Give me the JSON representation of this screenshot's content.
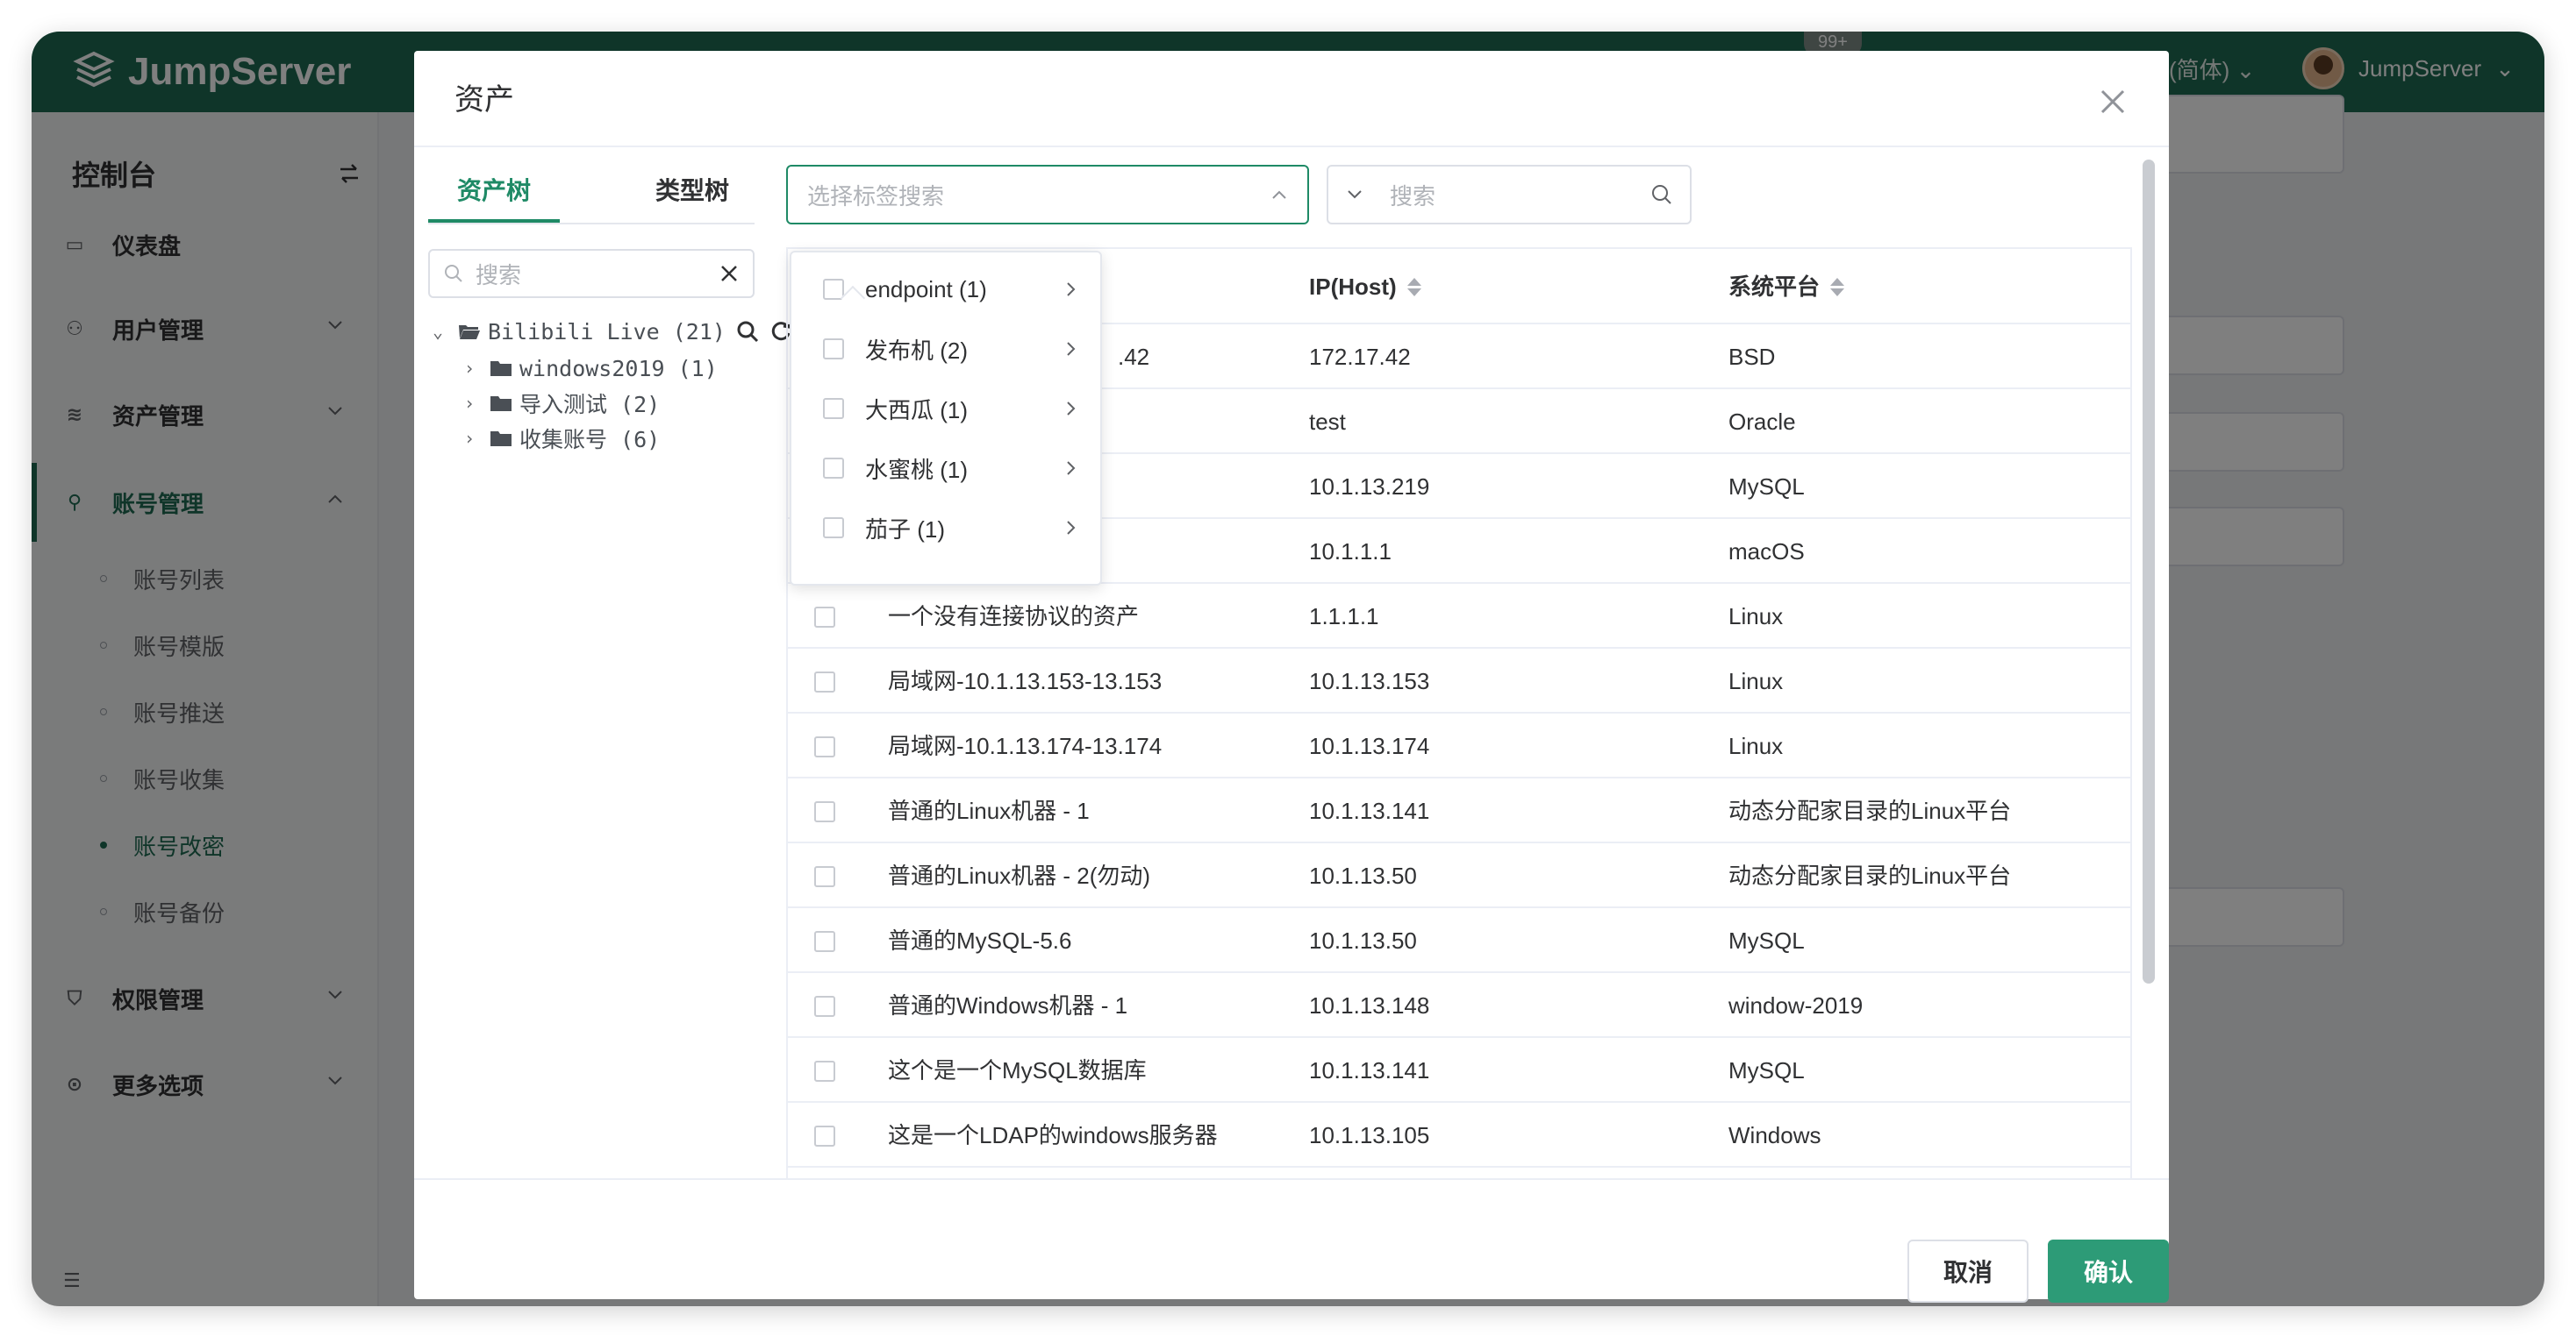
{
  "app": {
    "logo_text": "JumpServer",
    "notify_badge": "99+",
    "language": "(简体)",
    "username": "JumpServer"
  },
  "sidebar": {
    "title": "控制台",
    "items": [
      {
        "label": "仪表盘"
      },
      {
        "label": "用户管理"
      },
      {
        "label": "资产管理"
      },
      {
        "label": "账号管理"
      },
      {
        "label": "权限管理"
      },
      {
        "label": "更多选项"
      }
    ],
    "sub_items": [
      {
        "label": "账号列表"
      },
      {
        "label": "账号模版"
      },
      {
        "label": "账号推送"
      },
      {
        "label": "账号收集"
      },
      {
        "label": "账号改密"
      },
      {
        "label": "账号备份"
      }
    ]
  },
  "modal": {
    "title": "资产",
    "tabs": [
      {
        "label": "资产树"
      },
      {
        "label": "类型树"
      }
    ],
    "tree_search_placeholder": "搜索",
    "tree": {
      "root": "Bilibili Live (21)",
      "children": [
        "windows2019 (1)",
        "导入测试 (2)",
        "收集账号 (6)"
      ]
    },
    "tag_select_placeholder": "选择标签搜索",
    "search_placeholder": "搜索",
    "columns": [
      "IP(Host)",
      "系统平台"
    ],
    "rows": [
      {
        "name": "",
        "partial": ".42",
        "ip": "172.17.42",
        "platform": "BSD"
      },
      {
        "name": "",
        "partial": "",
        "ip": "test",
        "platform": "Oracle"
      },
      {
        "name": "",
        "partial": "",
        "ip": "10.1.13.219",
        "platform": "MySQL"
      },
      {
        "name": "",
        "partial": "",
        "ip": "10.1.1.1",
        "platform": "macOS"
      },
      {
        "name": "一个没有连接协议的资产",
        "partial": "",
        "ip": "1.1.1.1",
        "platform": "Linux"
      },
      {
        "name": "局域网-10.1.13.153-13.153",
        "partial": "",
        "ip": "10.1.13.153",
        "platform": "Linux"
      },
      {
        "name": "局域网-10.1.13.174-13.174",
        "partial": "",
        "ip": "10.1.13.174",
        "platform": "Linux"
      },
      {
        "name": "普通的Linux机器 - 1",
        "partial": "",
        "ip": "10.1.13.141",
        "platform": "动态分配家目录的Linux平台"
      },
      {
        "name": "普通的Linux机器 - 2(勿动)",
        "partial": "",
        "ip": "10.1.13.50",
        "platform": "动态分配家目录的Linux平台"
      },
      {
        "name": "普通的MySQL-5.6",
        "partial": "",
        "ip": "10.1.13.50",
        "platform": "MySQL"
      },
      {
        "name": "普通的Windows机器 - 1",
        "partial": "",
        "ip": "10.1.13.148",
        "platform": "window-2019"
      },
      {
        "name": "这个是一个MySQL数据库",
        "partial": "",
        "ip": "10.1.13.141",
        "platform": "MySQL"
      },
      {
        "name": "这是一个LDAP的windows服务器",
        "partial": "",
        "ip": "10.1.13.105",
        "platform": "Windows"
      }
    ],
    "tag_dropdown": [
      {
        "label": "endpoint (1)"
      },
      {
        "label": "发布机 (2)"
      },
      {
        "label": "大西瓜 (1)"
      },
      {
        "label": "水蜜桃 (1)"
      },
      {
        "label": "茄子 (1)"
      }
    ],
    "cancel_label": "取消",
    "confirm_label": "确认"
  },
  "colors": {
    "brand": "#1f6b52",
    "accent": "#2d9b77"
  },
  "icons": [
    "logo-icon",
    "swap-icon",
    "dashboard-icon",
    "users-icon",
    "assets-icon",
    "accounts-icon",
    "shield-icon",
    "more-icon",
    "search-icon",
    "close-icon",
    "refresh-icon",
    "folder-icon",
    "chevron-down-icon",
    "chevron-right-icon",
    "chevron-up-icon",
    "sort-icon"
  ]
}
